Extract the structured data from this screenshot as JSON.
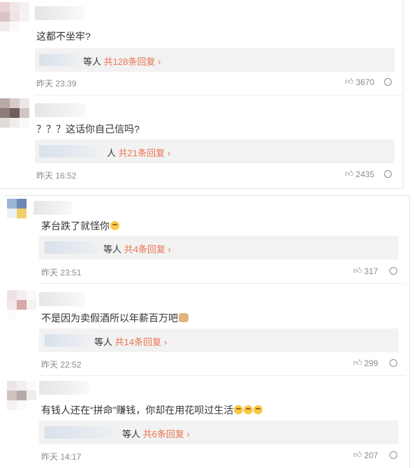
{
  "comments": [
    {
      "text": "这都不坐牢?",
      "reply_suffix": "等人",
      "reply_link": "共128条回复",
      "time": "昨天 23:39",
      "likes": "3670"
    },
    {
      "text": "？？？这话你自己信吗?",
      "reply_suffix": "人",
      "reply_link": "共21条回复",
      "time": "昨天 16:52",
      "likes": "2435"
    },
    {
      "text": "茅台跌了就怪你",
      "reply_suffix": "等人",
      "reply_link": "共4条回复",
      "time": "昨天 23:51",
      "likes": "317"
    },
    {
      "text": "不是因为卖假酒所以年薪百万吧",
      "reply_suffix": "等人",
      "reply_link": "共14条回复",
      "time": "昨天 22:52",
      "likes": "299"
    },
    {
      "text": "有钱人还在“拼命”赚钱，你却在用花呗过生活",
      "reply_suffix": "等人",
      "reply_link": "共6条回复",
      "time": "昨天 14:17",
      "likes": "207"
    }
  ],
  "colors": {
    "reply_link": "#eb7350",
    "meta": "#8c8c8c",
    "reply_bg": "#f2f2f2"
  },
  "icons": [
    "thumbs-up-icon",
    "reply-icon",
    "smile-emoji",
    "dog-emoji"
  ]
}
